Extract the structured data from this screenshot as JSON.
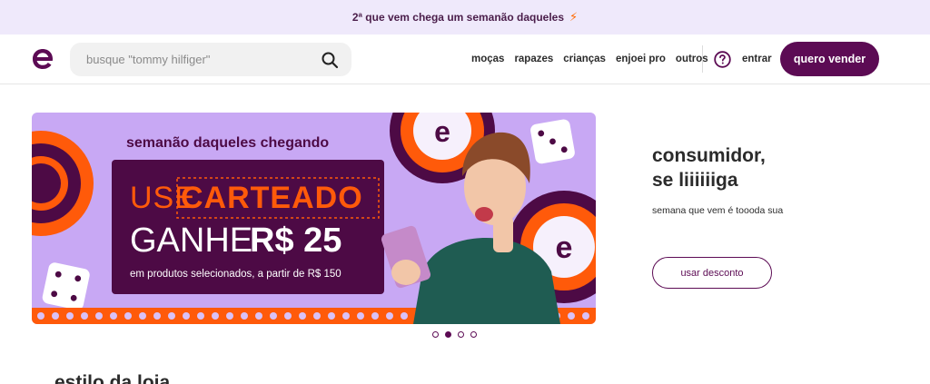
{
  "promo": {
    "text": "2ª que vem chega um semanão daqueles",
    "bolt": "⚡"
  },
  "header": {
    "logo_icon": "enjoei-e-logo-icon",
    "search": {
      "placeholder": "busque \"tommy hilfiger\"",
      "value": "",
      "icon": "search-icon"
    },
    "nav": [
      "moças",
      "rapazes",
      "crianças",
      "enjoei pro",
      "outros"
    ],
    "help_icon": "help-circle-icon",
    "login_label": "entrar",
    "sell_label": "quero vender"
  },
  "banner": {
    "headline": "semanão daqueles chegando",
    "use_label": "USE",
    "coupon_code": "CARTEADO",
    "ganhe_label": "GANHE",
    "amount": "R$ 25",
    "conditions": "em produtos selecionados, a partir de R$ 150"
  },
  "side": {
    "title_line1": "consumidor,",
    "title_line2": "se liiiiiiga",
    "subtitle": "semana que vem é toooda sua",
    "button_label": "usar desconto"
  },
  "carousel": {
    "slides": 4,
    "active_index": 1
  },
  "colors": {
    "brand": "#5c0b54",
    "accent": "#ff5a0a",
    "banner_bg": "#c8a8f4",
    "promo_bg": "#efe9fb"
  },
  "section": {
    "title": "estilo da loja"
  }
}
